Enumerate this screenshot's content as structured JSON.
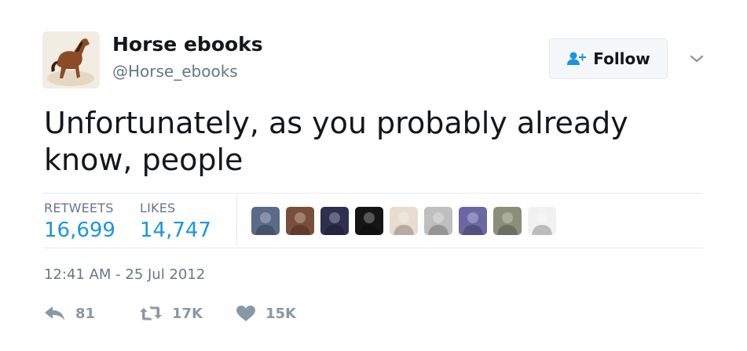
{
  "author": {
    "name": "Horse ebooks",
    "handle": "@Horse_ebooks",
    "avatar_icon": "horse-photo-avatar"
  },
  "follow_button": {
    "label": "Follow",
    "icon": "add-user-icon",
    "accent": "#1b95e0"
  },
  "tweet": {
    "text": "Unfortunately, as you probably already know, people",
    "timestamp": "12:41 AM - 25 Jul 2012"
  },
  "stats": {
    "retweets_label": "RETWEETS",
    "retweets_value": "16,699",
    "likes_label": "LIKES",
    "likes_value": "14,747"
  },
  "likers": [
    {
      "icon": "liker-avatar",
      "color": "#5a6a8a"
    },
    {
      "icon": "liker-avatar",
      "color": "#7a4e3a"
    },
    {
      "icon": "liker-avatar",
      "color": "#2f2f4f"
    },
    {
      "icon": "liker-avatar",
      "color": "#151515"
    },
    {
      "icon": "liker-avatar",
      "color": "#e8dccf"
    },
    {
      "icon": "liker-avatar",
      "color": "#bfbfbf"
    },
    {
      "icon": "liker-avatar",
      "color": "#6b67a3"
    },
    {
      "icon": "liker-avatar",
      "color": "#8b8f7a"
    },
    {
      "icon": "liker-avatar",
      "color": "#f1f1f1"
    }
  ],
  "actions": {
    "reply_count": "81",
    "retweet_count": "17K",
    "like_count": "15K"
  },
  "colors": {
    "text_primary": "#14171a",
    "text_secondary": "#657786",
    "link_blue": "#1b95e0",
    "icon_gray": "#8899a6",
    "divider": "#e6ecf0"
  }
}
